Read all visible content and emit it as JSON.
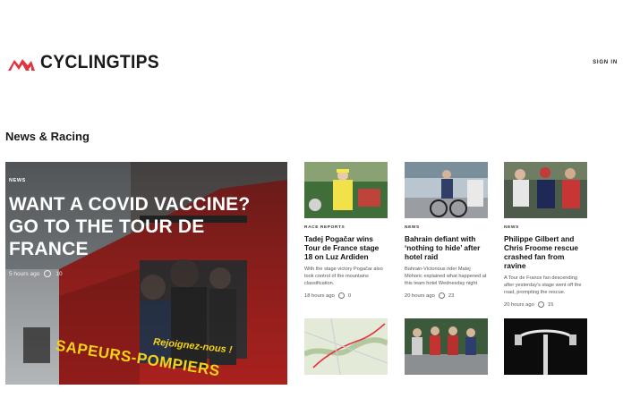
{
  "header": {
    "brand": "CYCLINGTIPS",
    "sign_in": "SIGN IN"
  },
  "section": {
    "title": "News & Racing"
  },
  "hero": {
    "tag": "NEWS",
    "title": "WANT A COVID VACCINE? GO TO THE TOUR DE FRANCE",
    "time": "5 hours ago",
    "comments": "10",
    "truck_text_1": "SAPEURS-POMPIERS",
    "truck_text_2": "Rejoignez-nous !"
  },
  "cards": [
    {
      "tag": "RACE REPORTS",
      "title": "Tadej Pogačar wins Tour de France stage 18 on Luz Ardiden",
      "excerpt": "With the stage victory Pogačar also took control of the mountains classification.",
      "time": "18 hours ago",
      "comments": "0"
    },
    {
      "tag": "NEWS",
      "title": "Bahrain defiant with ‘nothing to hide’ after hotel raid",
      "excerpt": "Bahrain-Victorious rider Matej Mohoric explained what happened at this team hotel Wednesday night",
      "time": "20 hours ago",
      "comments": "23"
    },
    {
      "tag": "NEWS",
      "title": "Philippe Gilbert and Chris Froome rescue crashed fan from ravine",
      "excerpt": "A Tour de France fan descending after yesterday's stage went off the road, prompting the rescue.",
      "time": "20 hours ago",
      "comments": "15"
    }
  ],
  "colors": {
    "brand_red": "#e2343f",
    "text": "#111111",
    "muted": "#555555"
  }
}
